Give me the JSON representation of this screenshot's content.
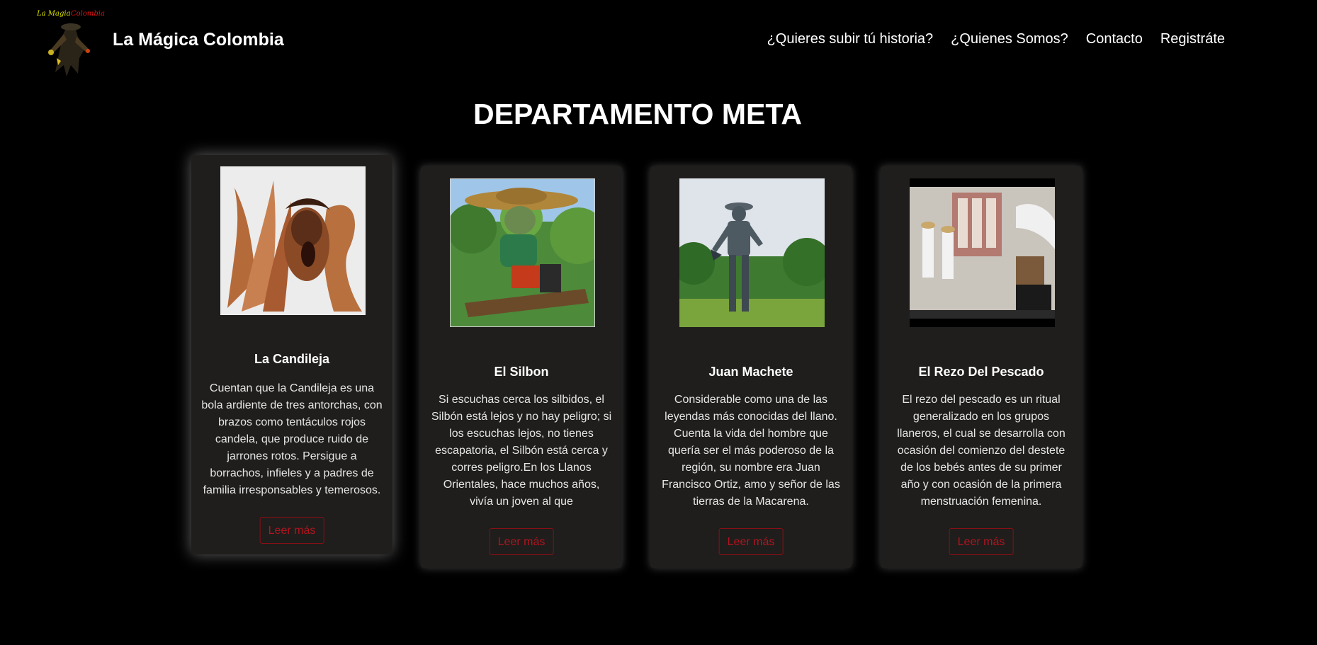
{
  "nav": {
    "logo_text": "La Magia Colombia",
    "brand": "La Mágica Colombia",
    "links": [
      "¿Quieres subir tú historia?",
      "¿Quienes Somos?",
      "Contacto",
      "Registráte"
    ]
  },
  "page": {
    "title": "DEPARTAMENTO META"
  },
  "cards": [
    {
      "title": "La Candileja",
      "text": "Cuentan que la Candileja es una bola ardiente de tres antorchas, con brazos como tentáculos rojos candela, que produce ruido de jarrones rotos. Persigue a borrachos, infieles y a padres de familia irresponsables y temerosos.",
      "button": "Leer más"
    },
    {
      "title": "El Silbon",
      "text": "Si escuchas cerca los silbidos, el Silbón está lejos y no hay peligro; si los escuchas lejos, no tienes escapatoria, el Silbón está cerca y corres peligro.En los Llanos Orientales, hace muchos años, vivía un joven al que",
      "button": "Leer más"
    },
    {
      "title": "Juan Machete",
      "text": "Considerable como una de las leyendas más conocidas del llano. Cuenta la vida del hombre que quería ser el más poderoso de la región, su nombre era Juan Francisco Ortiz, amo y señor de las tierras de la Macarena.",
      "button": "Leer más"
    },
    {
      "title": "El Rezo Del Pescado",
      "text": "El rezo del pescado es un ritual generalizado en los grupos llaneros, el cual se desarrolla con ocasión del comienzo del destete de los bebés antes de su primer año y con ocasión de la primera menstruación femenina.",
      "button": "Leer más"
    }
  ],
  "colors": {
    "background": "#000000",
    "card": "#1f1e1c",
    "button_accent": "#b3141f"
  }
}
